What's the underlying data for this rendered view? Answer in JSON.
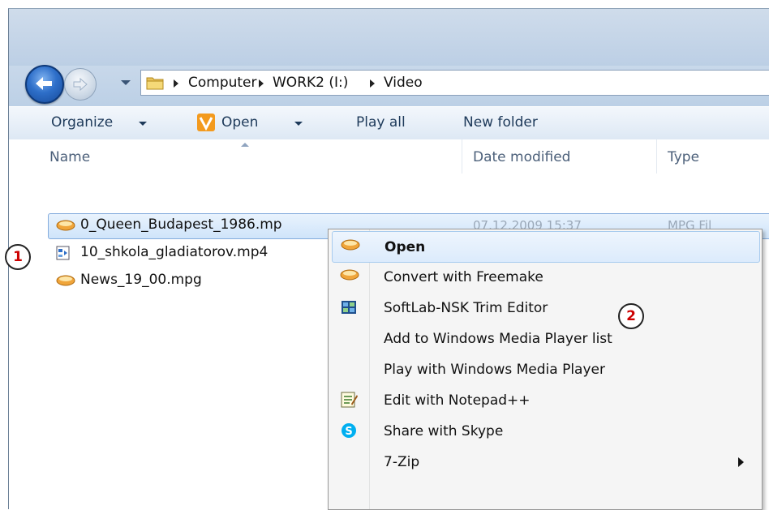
{
  "address_bar": {
    "crumbs": [
      "Computer",
      "WORK2 (I:)",
      "Video"
    ]
  },
  "toolbar": {
    "organize": "Organize",
    "open": "Open",
    "play_all": "Play all",
    "new_folder": "New folder"
  },
  "columns": {
    "name": "Name",
    "date_modified": "Date modified",
    "type": "Type"
  },
  "files": [
    {
      "name": "0_Queen_Budapest_1986.mp",
      "date": "07.12.2009 15:37",
      "type": "MPG Fil",
      "icon": "video-file-icon",
      "selected": true
    },
    {
      "name": "10_shkola_gladiatorov.mp4",
      "icon": "media-file-icon"
    },
    {
      "name": "News_19_00.mpg",
      "icon": "video-file-icon"
    }
  ],
  "context_menu": {
    "items": [
      {
        "label": "Open",
        "icon": "video-file-icon"
      },
      {
        "label": "Convert with Freemake",
        "icon": "freemake-icon"
      },
      {
        "label": "SoftLab-NSK Trim Editor",
        "icon": "trim-editor-icon"
      },
      {
        "label": "Add to Windows Media Player list",
        "icon": ""
      },
      {
        "label": "Play with Windows Media Player",
        "icon": ""
      },
      {
        "label": "Edit with Notepad++",
        "icon": "notepad-icon"
      },
      {
        "label": "Share with Skype",
        "icon": "skype-icon"
      },
      {
        "label": "7-Zip",
        "icon": "",
        "submenu": true
      }
    ]
  },
  "annotations": {
    "badge_1": "1",
    "badge_2": "2"
  },
  "colors": {
    "selection": "#cfe4fa",
    "badge_text": "#cc0000",
    "skype": "#00aff0"
  }
}
